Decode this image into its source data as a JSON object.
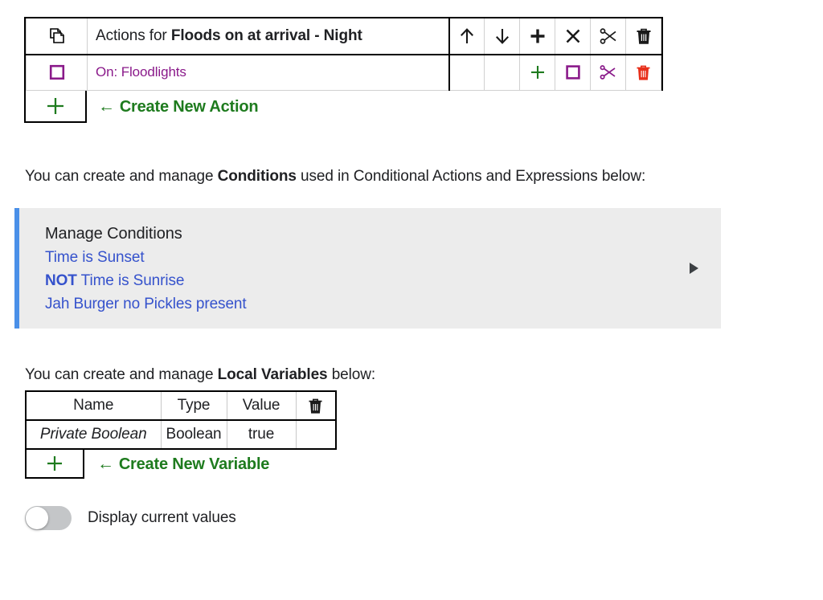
{
  "actions_table": {
    "duplicate_icon": "copy-pages-icon",
    "header": {
      "prefix": "Actions for ",
      "name": "Floods on at arrival - Night",
      "tools": [
        {
          "icon": "arrow-up-icon",
          "name": "move-up-button"
        },
        {
          "icon": "arrow-down-icon",
          "name": "move-down-button"
        },
        {
          "icon": "plus-icon",
          "name": "add-button"
        },
        {
          "icon": "close-x-icon",
          "name": "delete-all-button"
        },
        {
          "icon": "scissors-icon",
          "name": "cut-button"
        },
        {
          "icon": "trash-icon",
          "name": "trash-button"
        }
      ]
    },
    "rows": [
      {
        "select_icon": "checkbox-square-icon",
        "label": "On: Floodlights",
        "tools": [
          {
            "icon": "",
            "name": "blank-cell"
          },
          {
            "icon": "",
            "name": "blank-cell"
          },
          {
            "icon": "plus-icon",
            "name": "row-add-button"
          },
          {
            "icon": "square-icon",
            "name": "row-select-button"
          },
          {
            "icon": "scissors-icon",
            "name": "row-cut-button"
          },
          {
            "icon": "trash-icon",
            "name": "row-delete-button"
          }
        ]
      }
    ],
    "create_new": {
      "icon": "plus-icon",
      "arrow": "←",
      "label": "Create New Action"
    }
  },
  "conditions_section": {
    "intro_before": "You can create and manage ",
    "intro_bold": "Conditions",
    "intro_after": " used in Conditional Actions and Expressions below:",
    "panel_title": "Manage Conditions",
    "items": [
      {
        "prefix": "",
        "text": "Time is Sunset"
      },
      {
        "prefix": "NOT",
        "text": " Time is Sunrise"
      },
      {
        "prefix": "",
        "text": "Jah Burger no Pickles present"
      }
    ],
    "expand_icon": "play-triangle-right-icon"
  },
  "variables_section": {
    "intro_before": "You can create and manage ",
    "intro_bold": "Local Variables",
    "intro_after": " below:",
    "columns": [
      "Name",
      "Type",
      "Value"
    ],
    "delete_column_icon": "trash-icon",
    "rows": [
      {
        "name": "Private Boolean",
        "type": "Boolean",
        "value": "true"
      }
    ],
    "create_new": {
      "icon": "plus-icon",
      "arrow": "←",
      "label": "Create New Variable"
    }
  },
  "display_values_toggle": {
    "label": "Display current values",
    "state": "off"
  },
  "colors": {
    "purple": "#8A1A8A",
    "green": "#1E7B1E",
    "red": "#E8301B",
    "link_blue": "#3552CC",
    "accent_blue": "#4A90E8",
    "panel_gray": "#ECECEC"
  }
}
